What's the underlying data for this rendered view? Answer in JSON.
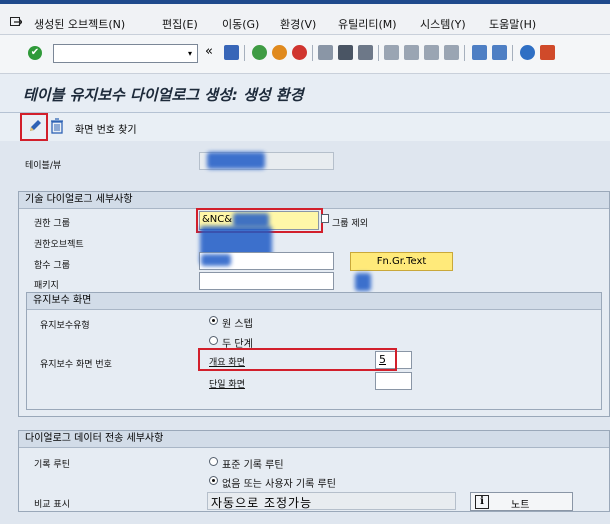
{
  "menu": {
    "items": [
      "생성된 오브젝트(N)",
      "편집(E)",
      "이동(G)",
      "환경(V)",
      "유틸리티(M)",
      "시스템(Y)",
      "도움말(H)"
    ]
  },
  "toolbar": {
    "command_value": "",
    "dropdown_glyph": "▾",
    "back_glyph": "«"
  },
  "page": {
    "title": "테이블 유지보수 다이얼로그 생성: 생성 환경"
  },
  "app_toolbar": {
    "find_screen_label": "화면 번호 찾기"
  },
  "table_view": {
    "label": "테이블/뷰"
  },
  "tech_details": {
    "title": "기술 다이얼로그 세부사항",
    "auth_group_label": "권한 그룹",
    "auth_group_value": "&NC&",
    "auth_group_exclude": "그룹 제외",
    "auth_object_label": "권한오브젝트",
    "func_group_label": "함수 그룹",
    "func_group_button": "Fn.Gr.Text",
    "package_label": "패키지"
  },
  "maint_screen": {
    "title": "유지보수 화면",
    "type_label": "유지보수유형",
    "one_step": "원 스텝",
    "two_step": "두 단계",
    "screen_no_label": "유지보수 화면 번호",
    "overview_label": "개요 화면",
    "overview_value": "5",
    "single_label": "단일 화면",
    "single_value": ""
  },
  "transport": {
    "title": "다이얼로그 데이터 전송 세부사항",
    "routine_label": "기록 루틴",
    "standard": "표준 기록 루틴",
    "none_user": "없음 또는 사용자 기록 루틴",
    "compare_label": "비교 표시",
    "compare_value": "자동으로 조정가능",
    "note_button": "노트",
    "info_glyph": "i"
  },
  "colors": {
    "highlight": "#d21f2b",
    "yellow_field": "#fff7a8",
    "button_yellow": "#ffea7a"
  }
}
